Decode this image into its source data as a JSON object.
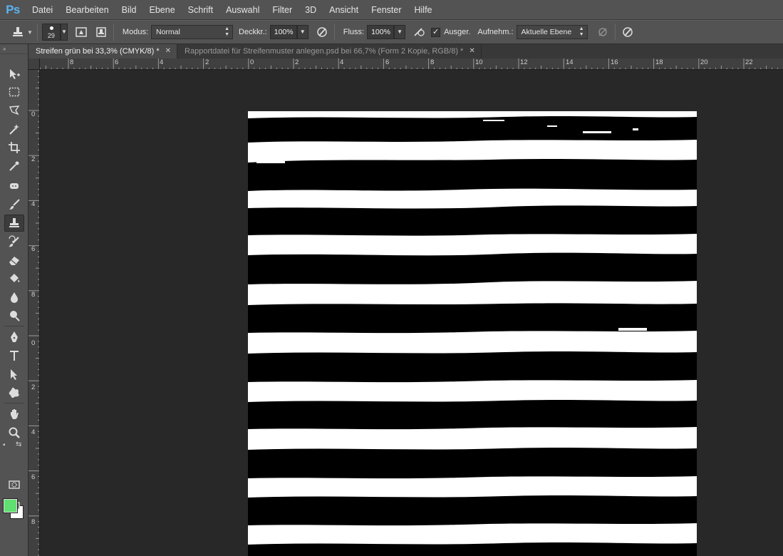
{
  "app": {
    "logo": "Ps"
  },
  "menu": [
    "Datei",
    "Bearbeiten",
    "Bild",
    "Ebene",
    "Schrift",
    "Auswahl",
    "Filter",
    "3D",
    "Ansicht",
    "Fenster",
    "Hilfe"
  ],
  "options": {
    "brush_size": "29",
    "modus_label": "Modus:",
    "modus_value": "Normal",
    "deckkraft_label": "Deckkr.:",
    "deckkraft_value": "100%",
    "fluss_label": "Fluss:",
    "fluss_value": "100%",
    "ausger_label": "Ausger.",
    "ausger_checked": true,
    "aufnehm_label": "Aufnehm.:",
    "aufnehm_value": "Aktuelle Ebene"
  },
  "tabs": [
    {
      "label": "Streifen grün bei 33,3% (CMYK/8) *",
      "active": true
    },
    {
      "label": "Rapportdatei für Streifenmuster anlegen.psd bei 66,7% (Form 2 Kopie, RGB/8) *",
      "active": false
    }
  ],
  "ruler_top_labels": [
    "8",
    "6",
    "4",
    "2",
    "0",
    "2",
    "4",
    "6",
    "8",
    "10",
    "12",
    "14",
    "16",
    "18",
    "20",
    "22"
  ],
  "ruler_left_labels": [
    "0",
    "2",
    "4",
    "6",
    "8",
    "0",
    "2",
    "4",
    "6",
    "8"
  ],
  "colors": {
    "foreground": "#5fe070",
    "background": "#ffffff"
  },
  "tools": [
    "move-tool-icon",
    "marquee-tool-icon",
    "lasso-tool-icon",
    "magic-wand-icon",
    "crop-tool-icon",
    "eyedropper-icon",
    "spot-healing-icon",
    "brush-tool-icon",
    "clone-stamp-icon",
    "history-brush-icon",
    "eraser-icon",
    "paint-bucket-icon",
    "blur-icon",
    "dodge-icon",
    "pen-tool-icon",
    "type-tool-icon",
    "path-selection-icon",
    "custom-shape-icon",
    "hand-tool-icon",
    "zoom-tool-icon"
  ]
}
